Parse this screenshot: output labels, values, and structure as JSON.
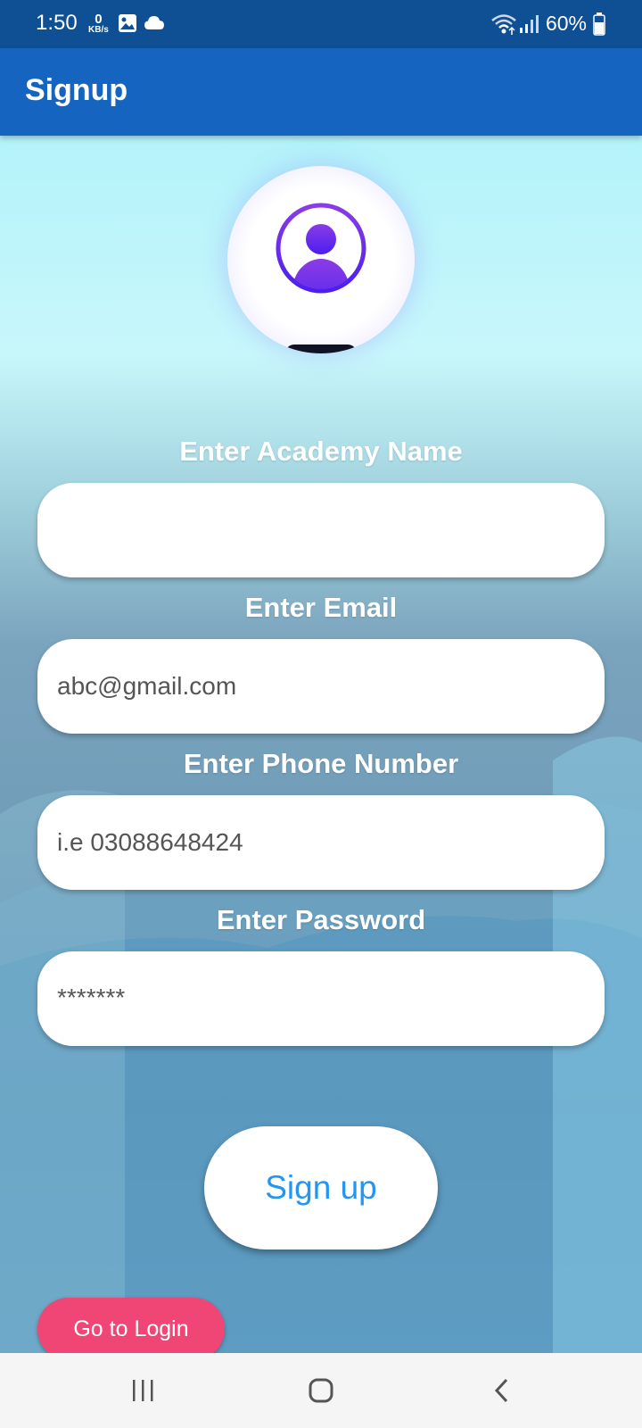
{
  "status_bar": {
    "time": "1:50",
    "net_speed_value": "0",
    "net_speed_unit": "KB/s",
    "battery": "60%",
    "icons": [
      "gallery-icon",
      "cloud-icon",
      "wifi-icon",
      "signal-icon",
      "battery-icon"
    ]
  },
  "app_bar": {
    "title": "Signup"
  },
  "avatar": {
    "icon": "account-circle-icon",
    "accent_color": "#6a2df0"
  },
  "form": {
    "academy": {
      "label": "Enter Academy Name",
      "placeholder": ""
    },
    "email": {
      "label": "Enter Email",
      "placeholder": "abc@gmail.com"
    },
    "phone": {
      "label": "Enter Phone Number",
      "placeholder": "i.e 03088648424"
    },
    "password": {
      "label": "Enter Password",
      "placeholder": "*******"
    }
  },
  "buttons": {
    "signup": "Sign up",
    "login": "Go to Login"
  },
  "colors": {
    "status_bar": "#0f4f93",
    "app_bar": "#1565c0",
    "signup_text": "#2196f3",
    "login_button": "#ef4675"
  },
  "nav_bar": {
    "icons": [
      "recent-apps-icon",
      "home-icon",
      "back-icon"
    ]
  }
}
